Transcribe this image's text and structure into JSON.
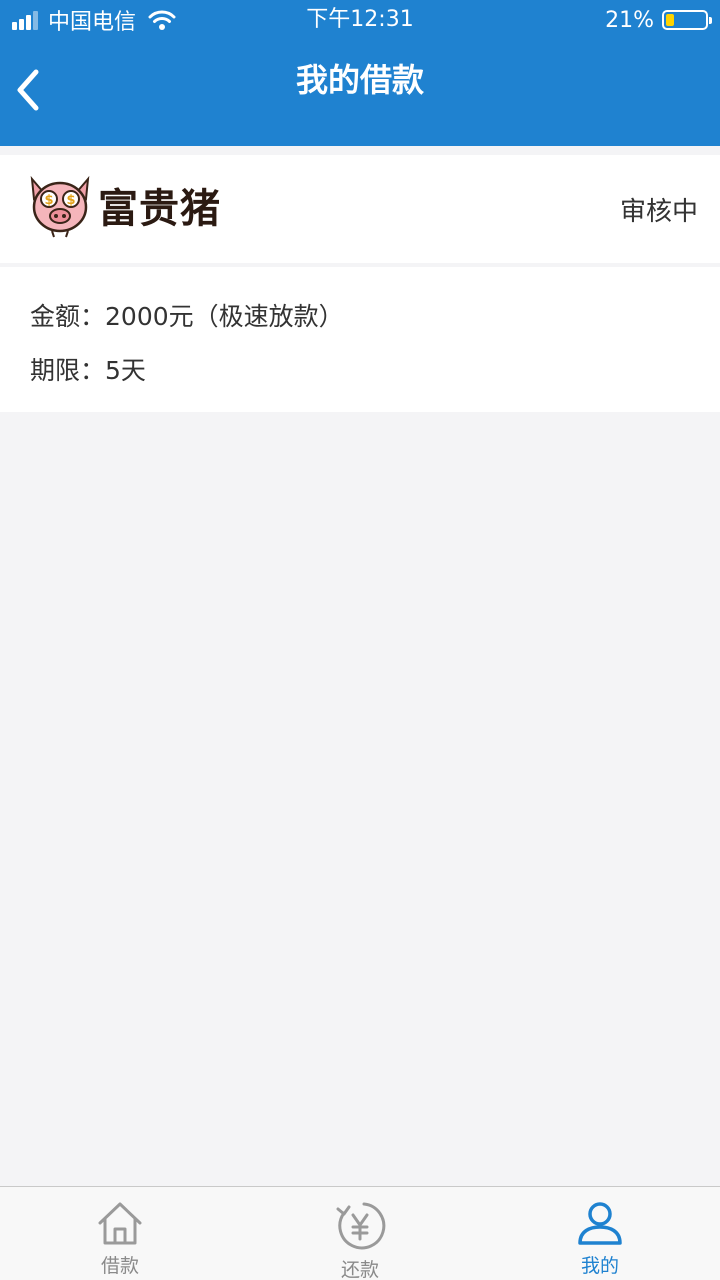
{
  "status_bar": {
    "carrier": "中国电信",
    "time": "下午12:31",
    "battery": "21%",
    "battery_level": 0.21
  },
  "nav": {
    "title": "我的借款",
    "back_icon": "chevron-left-icon"
  },
  "loan": {
    "brand": "富贵猪",
    "status": "审核中",
    "amount_label": "金额：",
    "amount_value": "2000元（极速放款）",
    "term_label": "期限：",
    "term_value": "5天"
  },
  "tabbar": {
    "items": [
      {
        "label": "借款",
        "icon": "home-icon",
        "active": false
      },
      {
        "label": "还款",
        "icon": "yuan-refresh-icon",
        "active": false
      },
      {
        "label": "我的",
        "icon": "user-icon",
        "active": true
      }
    ]
  },
  "colors": {
    "primary": "#1f82d0",
    "background": "#f4f4f6",
    "inactive_tab": "#8a8a8a",
    "battery": "#ffd400"
  }
}
